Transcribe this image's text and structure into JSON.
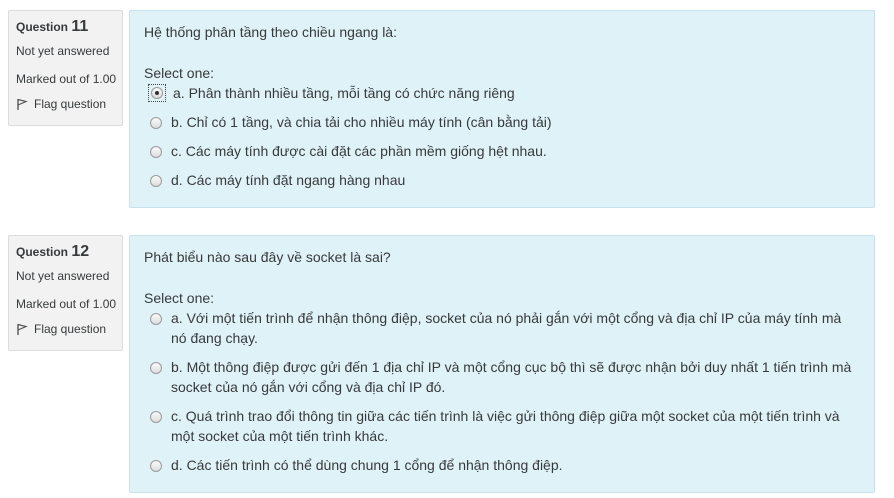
{
  "questions": [
    {
      "label": "Question",
      "number": "11",
      "state": "Not yet answered",
      "grade": "Marked out of 1.00",
      "flag_label": "Flag question",
      "text": "Hệ thống phân tầng theo chiều ngang là:",
      "prompt": "Select one:",
      "options": [
        {
          "text": "a. Phân thành nhiều tầng, mỗi tầng có chức năng riêng",
          "checked": true
        },
        {
          "text": "b. Chỉ có 1 tầng, và chia tải cho nhiều máy tính (cân bằng tải)",
          "checked": false
        },
        {
          "text": "c. Các máy tính được cài đặt các phần mềm giống hệt nhau.",
          "checked": false
        },
        {
          "text": "d. Các máy tính đặt ngang hàng nhau",
          "checked": false
        }
      ]
    },
    {
      "label": "Question",
      "number": "12",
      "state": "Not yet answered",
      "grade": "Marked out of 1.00",
      "flag_label": "Flag question",
      "text": "Phát biểu nào sau đây về socket là sai?",
      "prompt": "Select one:",
      "options": [
        {
          "text": "a. Với một tiến trình để nhận thông điệp, socket của nó phải gắn với một cổng và địa chỉ IP của máy tính mà nó đang chạy.",
          "checked": false
        },
        {
          "text": "b. Một thông điệp được gửi đến 1 địa chỉ IP và một cổng cục bộ thì sẽ được nhận bởi duy nhất 1 tiến trình mà socket của nó gắn với cổng và địa chỉ IP đó.",
          "checked": false
        },
        {
          "text": "c. Quá trình trao đổi thông tin giữa các tiến trình là việc gửi thông điệp giữa một socket của một tiến trình và một socket của một tiến trình khác.",
          "checked": false
        },
        {
          "text": "d. Các tiến trình có thể dùng chung 1 cổng để nhận thông điệp.",
          "checked": false
        }
      ]
    }
  ],
  "colors": {
    "info_bg": "#f2f2f2",
    "content_bg": "#def2f8",
    "content_border": "#c8e1ea"
  }
}
